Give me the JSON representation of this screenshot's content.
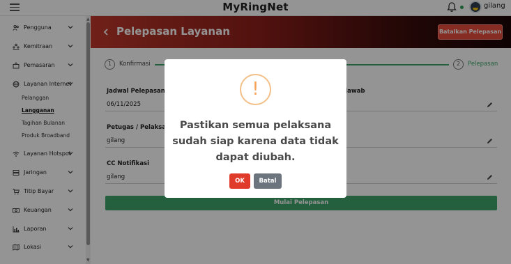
{
  "app": {
    "title": "MyRingNet",
    "username": "gilang"
  },
  "sidebar": {
    "items": [
      {
        "label": "Pengguna",
        "icon": "users-icon"
      },
      {
        "label": "Kemitraan",
        "icon": "partnership-icon"
      },
      {
        "label": "Pemasaran",
        "icon": "marketing-icon"
      },
      {
        "label": "Layanan Internet",
        "icon": "globe-icon"
      },
      {
        "label": "Layanan Hotspot",
        "icon": "wifi-icon"
      },
      {
        "label": "Jaringan",
        "icon": "server-icon"
      },
      {
        "label": "Titip Bayar",
        "icon": "cart-icon"
      },
      {
        "label": "Keuangan",
        "icon": "money-icon"
      },
      {
        "label": "Laporan",
        "icon": "chart-icon"
      },
      {
        "label": "Lokasi",
        "icon": "map-icon"
      }
    ],
    "subitems": [
      {
        "label": "Pelanggan",
        "active": false
      },
      {
        "label": "Langganan",
        "active": true
      },
      {
        "label": "Tagihan Bulanan",
        "active": false
      },
      {
        "label": "Produk Broadband",
        "active": false
      }
    ]
  },
  "header": {
    "title": "Pelepasan Layanan",
    "cancel_label": "Batalkan Pelepasan"
  },
  "stepper": {
    "steps": [
      {
        "number": "1",
        "label": "Konfirmasi"
      },
      {
        "number": "2",
        "label": "Pelepasan"
      }
    ]
  },
  "form": {
    "schedule_label": "Jadwal Pelepasan",
    "schedule_value": "06/11/2025",
    "responsible_label": "Jawab",
    "officer_label": "Petugas / Pelaksana",
    "officer_value": "gilang",
    "cc_label": "CC Notifikasi",
    "cc_value": "gilang",
    "submit_label": "Mulai Pelepasan"
  },
  "modal": {
    "icon": "!",
    "message": "Pastikan semua pelaksana sudah siap karena data tidak dapat diubah.",
    "ok_label": "OK",
    "cancel_label": "Batal"
  },
  "colors": {
    "accent_red": "#e74c3c",
    "header_dark": "#1a0606",
    "success_green": "#3ea66a",
    "warning_orange": "#f3a35b",
    "secondary_gray": "#6c757d"
  }
}
